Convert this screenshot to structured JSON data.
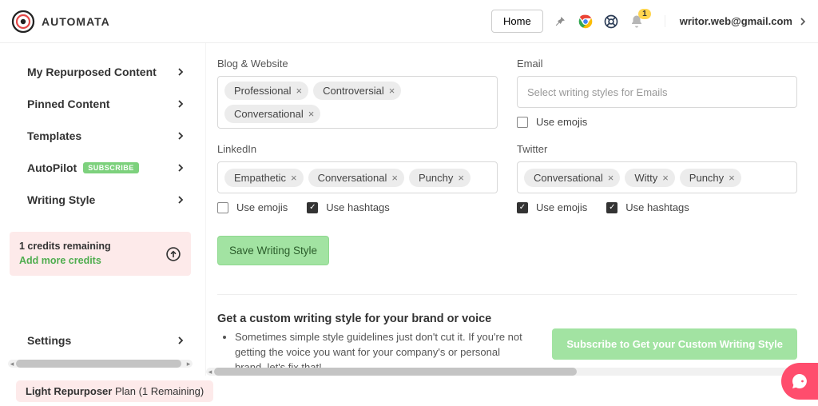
{
  "brand": {
    "name": "AUTOMATA"
  },
  "topbar": {
    "home_label": "Home",
    "notification_count": "1",
    "user_email": "writor.web@gmail.com"
  },
  "sidebar": {
    "items": [
      {
        "label": "My Repurposed Content"
      },
      {
        "label": "Pinned Content"
      },
      {
        "label": "Templates"
      },
      {
        "label": "AutoPilot",
        "badge": "SUBSCRIBE"
      },
      {
        "label": "Writing Style"
      }
    ],
    "credits": {
      "line1": "1 credits remaining",
      "line2": "Add more credits"
    },
    "settings_label": "Settings"
  },
  "sections": {
    "blog": {
      "title": "Blog & Website",
      "tags": [
        "Professional",
        "Controversial",
        "Conversational"
      ]
    },
    "email": {
      "title": "Email",
      "placeholder": "Select writing styles for Emails",
      "use_emojis_label": "Use emojis",
      "use_emojis_checked": false
    },
    "linkedin": {
      "title": "LinkedIn",
      "tags": [
        "Empathetic",
        "Conversational",
        "Punchy"
      ],
      "use_emojis_label": "Use emojis",
      "use_emojis_checked": false,
      "use_hashtags_label": "Use hashtags",
      "use_hashtags_checked": true
    },
    "twitter": {
      "title": "Twitter",
      "tags": [
        "Conversational",
        "Witty",
        "Punchy"
      ],
      "use_emojis_label": "Use emojis",
      "use_emojis_checked": true,
      "use_hashtags_label": "Use hashtags",
      "use_hashtags_checked": true
    }
  },
  "actions": {
    "save_label": "Save Writing Style"
  },
  "cta": {
    "title": "Get a custom writing style for your brand or voice",
    "bullet": "Sometimes simple style guidelines just don't cut it. If you're not getting the voice you want for your company's or personal brand, let's fix that!",
    "button_label": "Subscribe to Get your Custom Writing Style"
  },
  "planbar": {
    "plan_name": "Light Repurposer",
    "suffix": " Plan (1 Remaining)"
  }
}
